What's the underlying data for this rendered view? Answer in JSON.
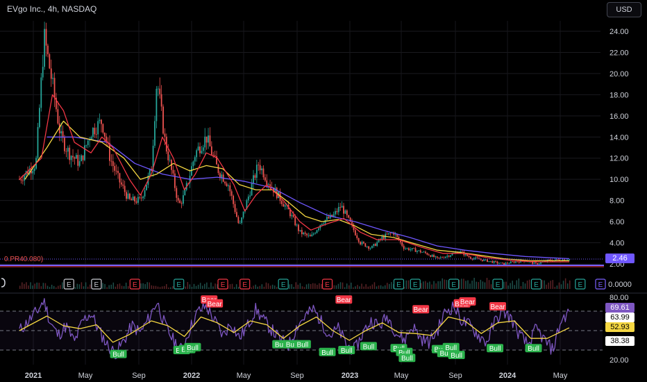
{
  "header": {
    "title": "EVgo Inc., 4h, NASDAQ",
    "currency": "USD"
  },
  "overlay_label": "0.PR40.080)",
  "price_tags": {
    "price": "2.46",
    "volume": "0.0000",
    "rsi_values": [
      "69.61",
      "63.99",
      "52.93",
      "38.38"
    ]
  },
  "colors": {
    "background": "#000000",
    "candles_up": "#26a69a",
    "candles_down": "#ef5350",
    "ma_fast": "#f23645",
    "ma_mid": "#f5d742",
    "ma_slow": "#6f57ff",
    "rsi_line": "#7e57c2",
    "rsi_signal": "#f5d742",
    "bull": "#2bb24c",
    "bear": "#f23645",
    "baseline": "#7b61ff"
  },
  "chart_data": [
    {
      "type": "candlestick",
      "x_ticks": [
        "2021",
        "May",
        "Sep",
        "2022",
        "May",
        "Sep",
        "2023",
        "May",
        "Sep",
        "2024",
        "May"
      ],
      "y_ticks": [
        "24.00",
        "22.00",
        "20.00",
        "18.00",
        "16.00",
        "14.00",
        "12.00",
        "10.00",
        "8.00",
        "6.00",
        "4.00",
        "2.00"
      ],
      "ylim": [
        2,
        24
      ],
      "close_path": [
        [
          0,
          10.0
        ],
        [
          0.03,
          11.5
        ],
        [
          0.045,
          23.5
        ],
        [
          0.06,
          19.0
        ],
        [
          0.075,
          14.0
        ],
        [
          0.09,
          12.5
        ],
        [
          0.11,
          11.5
        ],
        [
          0.13,
          14.5
        ],
        [
          0.15,
          15.5
        ],
        [
          0.165,
          12.0
        ],
        [
          0.18,
          10.0
        ],
        [
          0.2,
          8.0
        ],
        [
          0.22,
          8.0
        ],
        [
          0.24,
          11.0
        ],
        [
          0.25,
          19.5
        ],
        [
          0.265,
          13.5
        ],
        [
          0.28,
          10.0
        ],
        [
          0.29,
          7.5
        ],
        [
          0.3,
          8.5
        ],
        [
          0.32,
          12.5
        ],
        [
          0.34,
          14.0
        ],
        [
          0.36,
          11.0
        ],
        [
          0.38,
          9.5
        ],
        [
          0.4,
          5.5
        ],
        [
          0.42,
          9.0
        ],
        [
          0.435,
          11.5
        ],
        [
          0.45,
          10.0
        ],
        [
          0.47,
          8.5
        ],
        [
          0.49,
          7.0
        ],
        [
          0.51,
          5.0
        ],
        [
          0.53,
          4.5
        ],
        [
          0.55,
          6.0
        ],
        [
          0.57,
          6.5
        ],
        [
          0.585,
          7.5
        ],
        [
          0.6,
          6.0
        ],
        [
          0.62,
          4.0
        ],
        [
          0.64,
          3.5
        ],
        [
          0.66,
          4.5
        ],
        [
          0.68,
          5.0
        ],
        [
          0.7,
          3.5
        ],
        [
          0.72,
          3.3
        ],
        [
          0.74,
          3.0
        ],
        [
          0.76,
          2.5
        ],
        [
          0.78,
          2.8
        ],
        [
          0.8,
          3.2
        ],
        [
          0.82,
          2.6
        ],
        [
          0.84,
          2.4
        ],
        [
          0.86,
          2.2
        ],
        [
          0.88,
          2.0
        ],
        [
          0.9,
          2.2
        ],
        [
          0.92,
          2.3
        ],
        [
          0.94,
          2.0
        ],
        [
          0.96,
          2.3
        ],
        [
          1.0,
          2.46
        ]
      ],
      "ma_fast": [
        [
          0,
          10.0
        ],
        [
          0.04,
          12.0
        ],
        [
          0.06,
          18.0
        ],
        [
          0.08,
          16.5
        ],
        [
          0.1,
          13.5
        ],
        [
          0.13,
          12.5
        ],
        [
          0.15,
          14.0
        ],
        [
          0.17,
          13.0
        ],
        [
          0.2,
          10.0
        ],
        [
          0.22,
          8.5
        ],
        [
          0.24,
          10.5
        ],
        [
          0.26,
          14.0
        ],
        [
          0.28,
          12.0
        ],
        [
          0.3,
          9.0
        ],
        [
          0.32,
          10.5
        ],
        [
          0.34,
          12.5
        ],
        [
          0.36,
          12.0
        ],
        [
          0.39,
          9.5
        ],
        [
          0.41,
          7.0
        ],
        [
          0.43,
          8.5
        ],
        [
          0.45,
          9.5
        ],
        [
          0.48,
          8.0
        ],
        [
          0.51,
          6.0
        ],
        [
          0.53,
          5.2
        ],
        [
          0.56,
          5.8
        ],
        [
          0.59,
          6.3
        ],
        [
          0.62,
          5.0
        ],
        [
          0.65,
          4.3
        ],
        [
          0.69,
          4.3
        ],
        [
          0.73,
          3.6
        ],
        [
          0.77,
          3.0
        ],
        [
          0.81,
          3.0
        ],
        [
          0.85,
          2.6
        ],
        [
          0.9,
          2.3
        ],
        [
          0.95,
          2.2
        ],
        [
          1.0,
          2.2
        ]
      ],
      "ma_mid": [
        [
          0.01,
          10.0
        ],
        [
          0.05,
          13.0
        ],
        [
          0.08,
          15.5
        ],
        [
          0.11,
          14.0
        ],
        [
          0.15,
          13.5
        ],
        [
          0.19,
          12.0
        ],
        [
          0.22,
          10.0
        ],
        [
          0.25,
          10.5
        ],
        [
          0.28,
          11.5
        ],
        [
          0.31,
          10.8
        ],
        [
          0.34,
          11.3
        ],
        [
          0.37,
          11.0
        ],
        [
          0.4,
          9.5
        ],
        [
          0.43,
          9.0
        ],
        [
          0.46,
          9.0
        ],
        [
          0.49,
          7.8
        ],
        [
          0.52,
          6.5
        ],
        [
          0.55,
          6.0
        ],
        [
          0.58,
          6.2
        ],
        [
          0.61,
          5.6
        ],
        [
          0.64,
          4.8
        ],
        [
          0.68,
          4.5
        ],
        [
          0.72,
          3.9
        ],
        [
          0.76,
          3.3
        ],
        [
          0.8,
          3.1
        ],
        [
          0.84,
          2.8
        ],
        [
          0.88,
          2.5
        ],
        [
          0.93,
          2.3
        ],
        [
          1.0,
          2.3
        ]
      ],
      "ma_slow": [
        [
          0.05,
          14.0
        ],
        [
          0.1,
          14.0
        ],
        [
          0.16,
          13.5
        ],
        [
          0.21,
          11.5
        ],
        [
          0.26,
          10.5
        ],
        [
          0.31,
          10.0
        ],
        [
          0.36,
          10.2
        ],
        [
          0.41,
          9.8
        ],
        [
          0.46,
          9.2
        ],
        [
          0.51,
          7.8
        ],
        [
          0.56,
          6.6
        ],
        [
          0.61,
          6.0
        ],
        [
          0.66,
          5.2
        ],
        [
          0.71,
          4.5
        ],
        [
          0.76,
          3.7
        ],
        [
          0.81,
          3.3
        ],
        [
          0.86,
          3.0
        ],
        [
          0.92,
          2.7
        ],
        [
          1.0,
          2.5
        ]
      ],
      "last_price": 2.46
    },
    {
      "type": "bar",
      "name": "volume",
      "earnings_markers": [
        "E",
        "E",
        "E",
        "E",
        "E",
        "E",
        "E",
        "E",
        "E",
        "E",
        "E",
        "E",
        "E",
        "E",
        "E"
      ],
      "earnings_x": [
        0.09,
        0.14,
        0.21,
        0.29,
        0.37,
        0.41,
        0.48,
        0.56,
        0.69,
        0.72,
        0.79,
        0.87,
        0.94,
        1.02,
        1.34
      ],
      "earnings_colors": [
        "gray",
        "gray",
        "red",
        "teal",
        "red",
        "red",
        "teal",
        "red",
        "teal",
        "teal",
        "teal",
        "teal",
        "teal",
        "teal",
        "purple"
      ]
    },
    {
      "type": "line",
      "name": "RSI",
      "y_ticks": [
        "80.00",
        "20.00"
      ],
      "ylim": [
        20,
        85
      ],
      "levels": [
        70,
        50,
        30
      ],
      "rsi_path": [
        [
          0,
          50
        ],
        [
          0.02,
          62
        ],
        [
          0.035,
          72
        ],
        [
          0.045,
          82
        ],
        [
          0.055,
          60
        ],
        [
          0.07,
          45
        ],
        [
          0.085,
          55
        ],
        [
          0.1,
          38
        ],
        [
          0.115,
          60
        ],
        [
          0.13,
          68
        ],
        [
          0.145,
          50
        ],
        [
          0.16,
          35
        ],
        [
          0.175,
          26
        ],
        [
          0.19,
          40
        ],
        [
          0.205,
          55
        ],
        [
          0.22,
          48
        ],
        [
          0.235,
          62
        ],
        [
          0.25,
          80
        ],
        [
          0.265,
          55
        ],
        [
          0.28,
          40
        ],
        [
          0.295,
          30
        ],
        [
          0.31,
          52
        ],
        [
          0.325,
          70
        ],
        [
          0.34,
          75
        ],
        [
          0.355,
          60
        ],
        [
          0.37,
          45
        ],
        [
          0.385,
          58
        ],
        [
          0.4,
          42
        ],
        [
          0.415,
          55
        ],
        [
          0.43,
          72
        ],
        [
          0.445,
          60
        ],
        [
          0.46,
          50
        ],
        [
          0.475,
          40
        ],
        [
          0.49,
          35
        ],
        [
          0.505,
          55
        ],
        [
          0.52,
          65
        ],
        [
          0.535,
          72
        ],
        [
          0.55,
          58
        ],
        [
          0.565,
          45
        ],
        [
          0.58,
          52
        ],
        [
          0.595,
          35
        ],
        [
          0.61,
          30
        ],
        [
          0.625,
          48
        ],
        [
          0.64,
          60
        ],
        [
          0.655,
          55
        ],
        [
          0.67,
          65
        ],
        [
          0.685,
          48
        ],
        [
          0.7,
          40
        ],
        [
          0.715,
          55
        ],
        [
          0.73,
          42
        ],
        [
          0.745,
          38
        ],
        [
          0.76,
          50
        ],
        [
          0.775,
          70
        ],
        [
          0.79,
          75
        ],
        [
          0.805,
          60
        ],
        [
          0.82,
          55
        ],
        [
          0.835,
          45
        ],
        [
          0.85,
          38
        ],
        [
          0.865,
          60
        ],
        [
          0.88,
          70
        ],
        [
          0.895,
          62
        ],
        [
          0.91,
          45
        ],
        [
          0.925,
          35
        ],
        [
          0.94,
          52
        ],
        [
          0.955,
          40
        ],
        [
          0.97,
          30
        ],
        [
          0.985,
          60
        ],
        [
          1.0,
          69.61
        ]
      ],
      "signal_path": [
        [
          0,
          50
        ],
        [
          0.05,
          65
        ],
        [
          0.08,
          55
        ],
        [
          0.11,
          52
        ],
        [
          0.14,
          56
        ],
        [
          0.17,
          38
        ],
        [
          0.2,
          46
        ],
        [
          0.24,
          60
        ],
        [
          0.27,
          55
        ],
        [
          0.3,
          44
        ],
        [
          0.33,
          64
        ],
        [
          0.36,
          58
        ],
        [
          0.39,
          48
        ],
        [
          0.42,
          60
        ],
        [
          0.45,
          56
        ],
        [
          0.48,
          42
        ],
        [
          0.51,
          55
        ],
        [
          0.54,
          64
        ],
        [
          0.57,
          50
        ],
        [
          0.6,
          40
        ],
        [
          0.63,
          50
        ],
        [
          0.66,
          58
        ],
        [
          0.69,
          48
        ],
        [
          0.72,
          47
        ],
        [
          0.75,
          45
        ],
        [
          0.78,
          64
        ],
        [
          0.81,
          60
        ],
        [
          0.84,
          47
        ],
        [
          0.87,
          58
        ],
        [
          0.9,
          60
        ],
        [
          0.93,
          42
        ],
        [
          0.96,
          42
        ],
        [
          1.0,
          52.93
        ]
      ],
      "bear_labels": [
        {
          "text": "Bear",
          "x": 0.345,
          "rsi": 82
        },
        {
          "text": "Bear",
          "x": 0.355,
          "rsi": 78
        },
        {
          "text": "Bear",
          "x": 0.59,
          "rsi": 82
        },
        {
          "text": "Bear",
          "x": 0.73,
          "rsi": 72
        },
        {
          "text": "Bear",
          "x": 0.805,
          "rsi": 78
        },
        {
          "text": "Bear",
          "x": 0.815,
          "rsi": 80
        },
        {
          "text": "Bear",
          "x": 0.87,
          "rsi": 75
        }
      ],
      "bull_labels": [
        {
          "text": "Bull",
          "x": 0.18,
          "rsi": 26
        },
        {
          "text": "Bull",
          "x": 0.295,
          "rsi": 30
        },
        {
          "text": "Bull",
          "x": 0.305,
          "rsi": 31
        },
        {
          "text": "Bull",
          "x": 0.315,
          "rsi": 33
        },
        {
          "text": "Bull",
          "x": 0.475,
          "rsi": 36
        },
        {
          "text": "Bull",
          "x": 0.495,
          "rsi": 36
        },
        {
          "text": "Bull",
          "x": 0.515,
          "rsi": 36
        },
        {
          "text": "Bull",
          "x": 0.56,
          "rsi": 28
        },
        {
          "text": "Bull",
          "x": 0.595,
          "rsi": 30
        },
        {
          "text": "Bull",
          "x": 0.635,
          "rsi": 34
        },
        {
          "text": "Bull",
          "x": 0.69,
          "rsi": 32
        },
        {
          "text": "Bull",
          "x": 0.7,
          "rsi": 28
        },
        {
          "text": "Bull",
          "x": 0.705,
          "rsi": 22
        },
        {
          "text": "Bull",
          "x": 0.765,
          "rsi": 31
        },
        {
          "text": "Bull",
          "x": 0.775,
          "rsi": 27
        },
        {
          "text": "Bull",
          "x": 0.785,
          "rsi": 33
        },
        {
          "text": "Bull",
          "x": 0.795,
          "rsi": 25
        },
        {
          "text": "Bull",
          "x": 0.865,
          "rsi": 32
        },
        {
          "text": "Bull",
          "x": 0.935,
          "rsi": 32
        }
      ]
    }
  ]
}
